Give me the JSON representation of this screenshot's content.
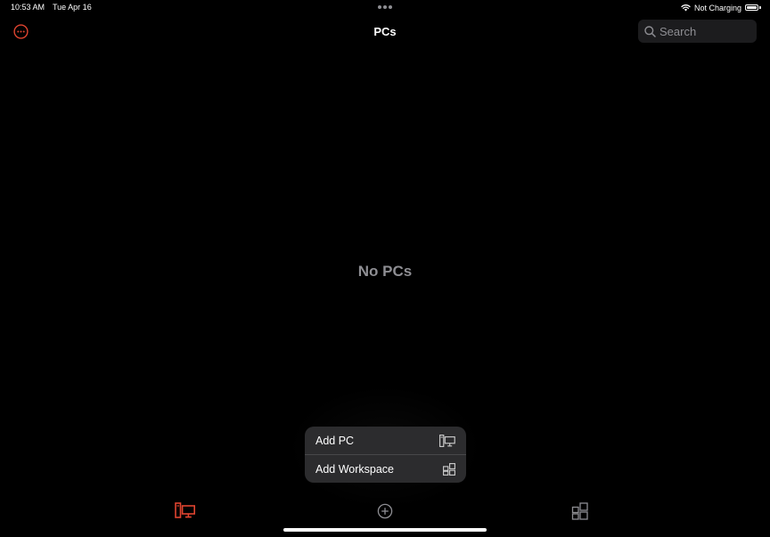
{
  "status_bar": {
    "time": "10:53 AM",
    "date": "Tue Apr 16",
    "charging_status": "Not Charging",
    "icons": [
      "wifi-icon",
      "battery-icon"
    ]
  },
  "nav": {
    "title": "PCs",
    "more_icon": "ellipsis-circle-icon",
    "search": {
      "placeholder": "Search",
      "value": "",
      "icon": "search-icon"
    }
  },
  "main": {
    "empty_message": "No PCs"
  },
  "add_menu": {
    "items": [
      {
        "label": "Add PC",
        "icon": "pc-icon"
      },
      {
        "label": "Add Workspace",
        "icon": "workspace-icon"
      }
    ]
  },
  "tab_bar": {
    "tabs": [
      {
        "name": "pcs",
        "icon": "pc-icon",
        "selected": true
      },
      {
        "name": "add",
        "icon": "plus-circle-icon",
        "selected": false
      },
      {
        "name": "workspaces",
        "icon": "workspace-icon",
        "selected": false
      }
    ]
  },
  "colors": {
    "accent": "#e0442f",
    "background": "#000000",
    "secondary_text": "#8e8e93",
    "menu_background": "#2c2c2e",
    "search_background": "#1c1c1e"
  }
}
